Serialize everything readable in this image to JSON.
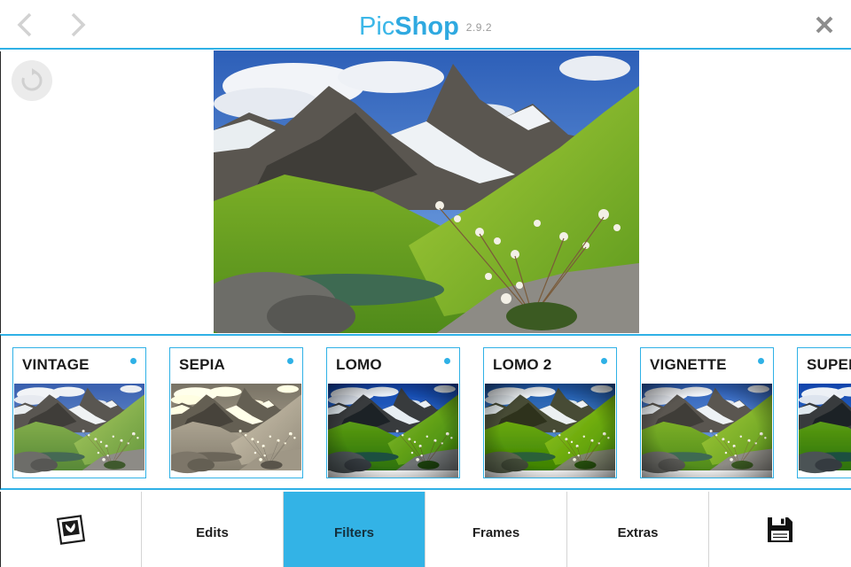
{
  "header": {
    "title_part1": "Pic",
    "title_part2": "Shop",
    "version": "2.9.2",
    "back_icon": "chevron-left-icon",
    "forward_icon": "chevron-right-icon",
    "close_icon": "close-icon"
  },
  "main": {
    "rotate_icon": "rotate-icon",
    "photo": "mountain-landscape-photo"
  },
  "filters": [
    {
      "label": "VINTAGE",
      "style": "vintage"
    },
    {
      "label": "SEPIA",
      "style": "sepia"
    },
    {
      "label": "LOMO",
      "style": "lomo"
    },
    {
      "label": "LOMO 2",
      "style": "lomo2"
    },
    {
      "label": "VIGNETTE",
      "style": "vignette"
    },
    {
      "label": "SUPER",
      "style": "super"
    }
  ],
  "tabs": [
    {
      "label": "",
      "icon": "gallery-icon"
    },
    {
      "label": "Edits"
    },
    {
      "label": "Filters",
      "active": true
    },
    {
      "label": "Frames"
    },
    {
      "label": "Extras"
    },
    {
      "label": "",
      "icon": "save-icon"
    }
  ],
  "colors": {
    "accent": "#2fb1e6",
    "active_tab": "#33b3e6",
    "dot": "#2fb1e6"
  }
}
